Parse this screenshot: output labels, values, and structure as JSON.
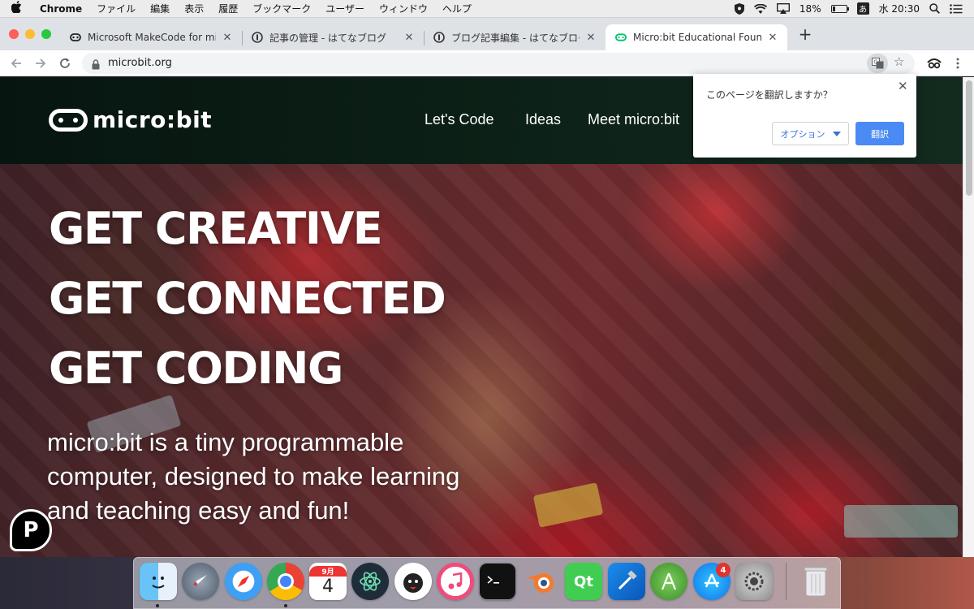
{
  "menubar": {
    "app_name": "Chrome",
    "menus": [
      "ファイル",
      "編集",
      "表示",
      "履歴",
      "ブックマーク",
      "ユーザー",
      "ウィンドウ",
      "ヘルプ"
    ],
    "battery_text": "18%",
    "battery_level": 0.18,
    "ime_label": "あ",
    "clock": "水 20:30"
  },
  "tabs": [
    {
      "title": "Microsoft MakeCode for microbit",
      "icon": "makecode-icon"
    },
    {
      "title": "記事の管理 - はてなブログ",
      "icon": "hatena-icon"
    },
    {
      "title": "ブログ記事編集 - はてなブログ",
      "icon": "hatena-icon"
    },
    {
      "title": "Micro:bit Educational Foundation",
      "icon": "microbit-icon"
    }
  ],
  "address_bar": {
    "url": "microbit.org"
  },
  "translate_popup": {
    "question": "このページを翻訳しますか？",
    "options_label": "オプション",
    "translate_label": "翻訳"
  },
  "site": {
    "logo_text": "micro:bit",
    "nav": [
      "Let's Code",
      "Ideas",
      "Meet micro:bit"
    ],
    "hero_lines": [
      "GET CREATIVE",
      "GET CONNECTED",
      "GET CODING"
    ],
    "hero_subtitle": "micro:bit is a tiny programmable computer, designed to make learning and teaching easy and fun!",
    "chat_badge": "P"
  },
  "dock": {
    "calendar_month": "9月",
    "calendar_day": "4",
    "qt_label": "Qt",
    "app_store_badge": "4"
  },
  "colors": {
    "brand_dark": "#0d2218",
    "popup_button": "#4a8af4",
    "active_tab_icon": "#00c26a"
  }
}
